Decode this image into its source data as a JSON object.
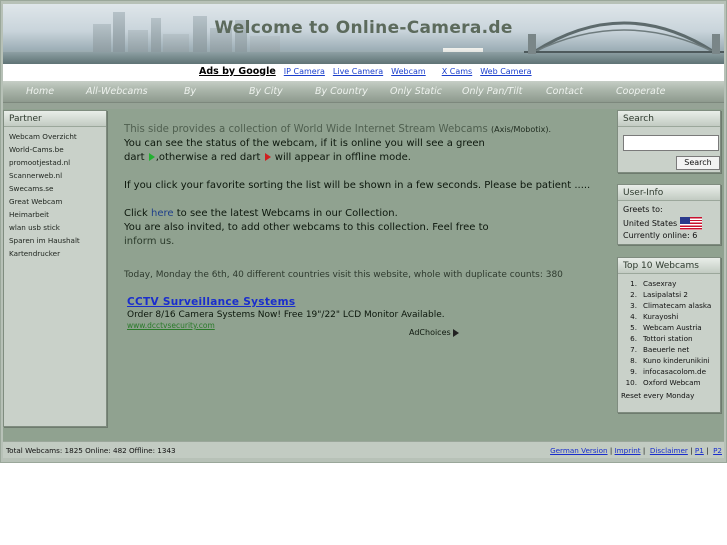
{
  "header": {
    "title": "Welcome to Online-Camera.de"
  },
  "ads": {
    "label": "Ads by Google",
    "links": [
      "IP Camera",
      "Live Camera",
      "Webcam",
      "X Cams",
      "Web Camera"
    ]
  },
  "nav": {
    "items": [
      "Home",
      "All-Webcams",
      "By",
      "By City",
      "By Country",
      "Only Static",
      "Only Pan/Tilt",
      "Contact",
      "Cooperate"
    ]
  },
  "partner": {
    "title": "Partner",
    "items": [
      "Webcam Overzicht",
      "World-Cams.be",
      "promootjestad.nl",
      "Scannerweb.nl",
      "Swecams.se",
      "Great Webcam",
      "Heimarbeit",
      "wlan usb stick",
      "Sparen im Haushalt",
      "Kartendrucker"
    ]
  },
  "content": {
    "intro": "This side provides a collection of World Wide Internet Stream Webcams",
    "intro_small": "(Axis/Mobotix).",
    "status_line1": "You can see the status of the webcam, if it is online you will see a green",
    "status_line2a": "dart",
    "status_line2b": ",otherwise a red dart",
    "status_line2c": "will appear in offline mode.",
    "sort_text": "If you click your favorite sorting the list will be shown in a few seconds. Please be patient  .....",
    "click_a": "Click",
    "here_link": "here",
    "click_b": "to see the latest Webcams in our Collection.",
    "invite_line1": "You are also invited, to add other webcams to this collection. Feel free to",
    "inform_link": "inform us.",
    "visit_stats": "Today, Monday the 6th, 40 different countries visit this website, whole with duplicate counts: 380"
  },
  "ad": {
    "title": "CCTV Surveillance Systems",
    "text": "Order 8/16 Camera Systems Now! Free 19\"/22\" LCD Monitor Available.",
    "url": "www.dcctvsecurity.com",
    "choices": "AdChoices"
  },
  "search": {
    "title": "Search",
    "button": "Search",
    "value": ""
  },
  "userinfo": {
    "title": "User-Info",
    "greets": "Greets to:",
    "country": "United States",
    "online": "Currently online:  6"
  },
  "top10": {
    "title": "Top 10 Webcams",
    "items": [
      "Casexray",
      "Lasipalatsi 2",
      "Climatecam alaska",
      "Kurayoshi",
      "Webcam Austria",
      "Tottori station",
      "Baeuerle net",
      "Kuno kinderunikini",
      "infocasacolom.de",
      "Oxford Webcam"
    ],
    "reset": "Reset every Monday"
  },
  "footer": {
    "totals": "Total Webcams: 1825  Online: 482  Offline: 1343",
    "german": "German Version",
    "imprint": "Imprint",
    "disclaimer": "Disclaimer",
    "p1": "P1",
    "p2": "P2"
  },
  "colors": {
    "page_bg": "#90a290",
    "link": "#1a2ecc",
    "green_dart": "#22b030",
    "red_dart": "#d02020"
  }
}
